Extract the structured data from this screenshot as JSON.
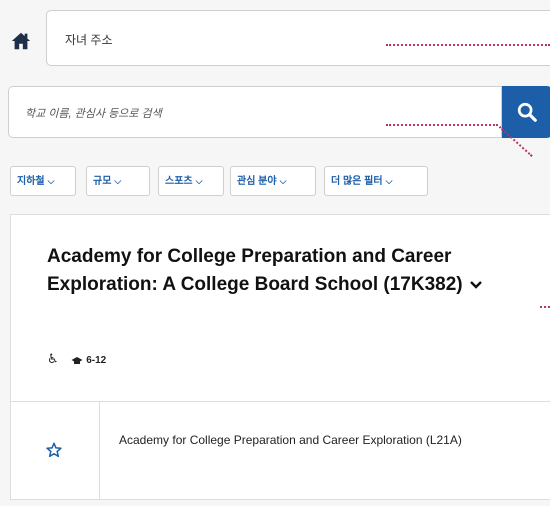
{
  "address": {
    "placeholder": "자녀 주소"
  },
  "search": {
    "placeholder": "학교 이름, 관심사 등으로 검색"
  },
  "filters": [
    {
      "label": "지하철"
    },
    {
      "label": "규모"
    },
    {
      "label": "스포츠"
    },
    {
      "label": "관심 분야"
    },
    {
      "label": "더 많은 필터"
    }
  ],
  "school": {
    "name": "Academy for College Preparation and Career Exploration: A College Board School (17K382)",
    "grades": "6-12",
    "program": "Academy for College Preparation and Career Exploration (L21A)"
  },
  "colors": {
    "accent": "#1c5ea8",
    "callout": "#c0306a"
  },
  "icons": [
    "home-icon",
    "search-icon",
    "chevron-down-icon",
    "accessibility-icon",
    "graduation-cap-icon",
    "star-outline-icon"
  ]
}
